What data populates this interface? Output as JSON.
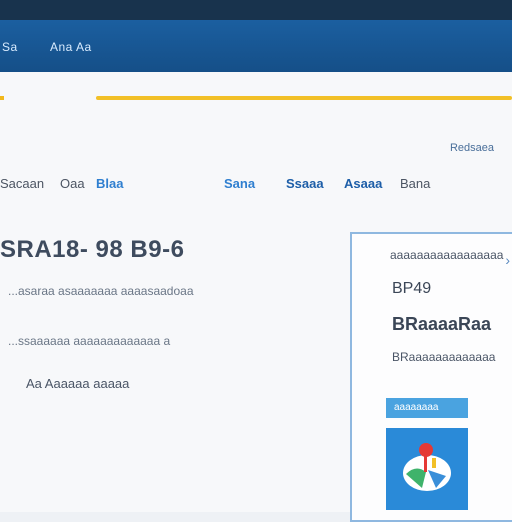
{
  "window": {
    "colors": {
      "topbar": "#18334d",
      "navbar": "#1b5fa0",
      "accent": "#f2c027"
    }
  },
  "nav": {
    "items": [
      {
        "label": "Sa"
      },
      {
        "label": "Ana Aa"
      }
    ]
  },
  "header": {
    "top_link": "Redsaea"
  },
  "filters": [
    {
      "label": "Sacaan"
    },
    {
      "label": "Oaa"
    },
    {
      "label": "Blaa"
    },
    {
      "label": "Sana"
    },
    {
      "label": "Ssaaa"
    },
    {
      "label": "Asaaa"
    },
    {
      "label": "Bana"
    }
  ],
  "main": {
    "heading": "SRA18- 98  B9-6",
    "description_1": "...asaraa asaaaaaaa aaaasaadoaa",
    "description_2": "...ssaaaaaa aaaaaaaaaaaaa a",
    "meta": "Aa Aaaaaa aaaaa"
  },
  "panel": {
    "title": "aaaaaaaaaaaaaaaaa",
    "value": "BP49",
    "label": "BRaaaaRaa",
    "note": "BRaaaaaaaaaaaaa",
    "button": "aaaaaaaa",
    "icon": "map-pin-app-icon"
  }
}
